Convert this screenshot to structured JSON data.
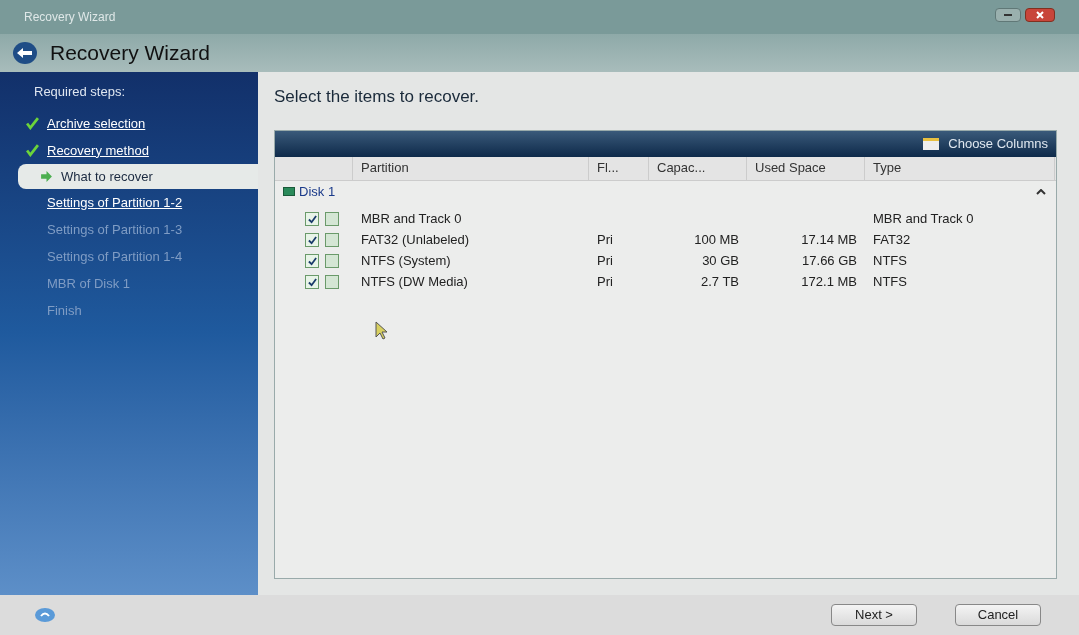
{
  "window": {
    "title": "Recovery Wizard"
  },
  "header": {
    "title": "Recovery Wizard"
  },
  "sidebar": {
    "heading": "Required steps:",
    "items": [
      {
        "label": "Archive selection",
        "kind": "done"
      },
      {
        "label": "Recovery method",
        "kind": "done"
      },
      {
        "label": "What to recover",
        "kind": "current"
      },
      {
        "label": "Settings of Partition 1-2",
        "kind": "available"
      },
      {
        "label": "Settings of Partition 1-3",
        "kind": "disabled"
      },
      {
        "label": "Settings of Partition 1-4",
        "kind": "disabled"
      },
      {
        "label": "MBR of Disk 1",
        "kind": "disabled"
      },
      {
        "label": "Finish",
        "kind": "disabled"
      }
    ]
  },
  "main": {
    "heading": "Select the items to recover.",
    "toolbar": {
      "choose_columns": "Choose Columns"
    },
    "table": {
      "columns": [
        "Partition",
        "Fl...",
        "Capac...",
        "Used Space",
        "Type"
      ],
      "group": {
        "label": "Disk 1",
        "expanded": true
      },
      "rows": [
        {
          "checked": true,
          "checked_2": false,
          "cells": [
            "MBR and Track 0",
            "",
            "",
            "",
            "MBR and Track 0"
          ]
        },
        {
          "checked": true,
          "checked_2": false,
          "cells": [
            "FAT32 (Unlabeled)",
            "Pri",
            "100 MB",
            "17.14 MB",
            "FAT32"
          ]
        },
        {
          "checked": true,
          "checked_2": false,
          "cells": [
            "NTFS (System)",
            "Pri",
            "30 GB",
            "17.66 GB",
            "NTFS"
          ]
        },
        {
          "checked": true,
          "checked_2": false,
          "cells": [
            "NTFS (DW Media)",
            "Pri",
            "2.7 TB",
            "172.1 MB",
            "NTFS"
          ]
        }
      ]
    }
  },
  "footer": {
    "buttons": [
      "Next >",
      "Cancel"
    ]
  }
}
